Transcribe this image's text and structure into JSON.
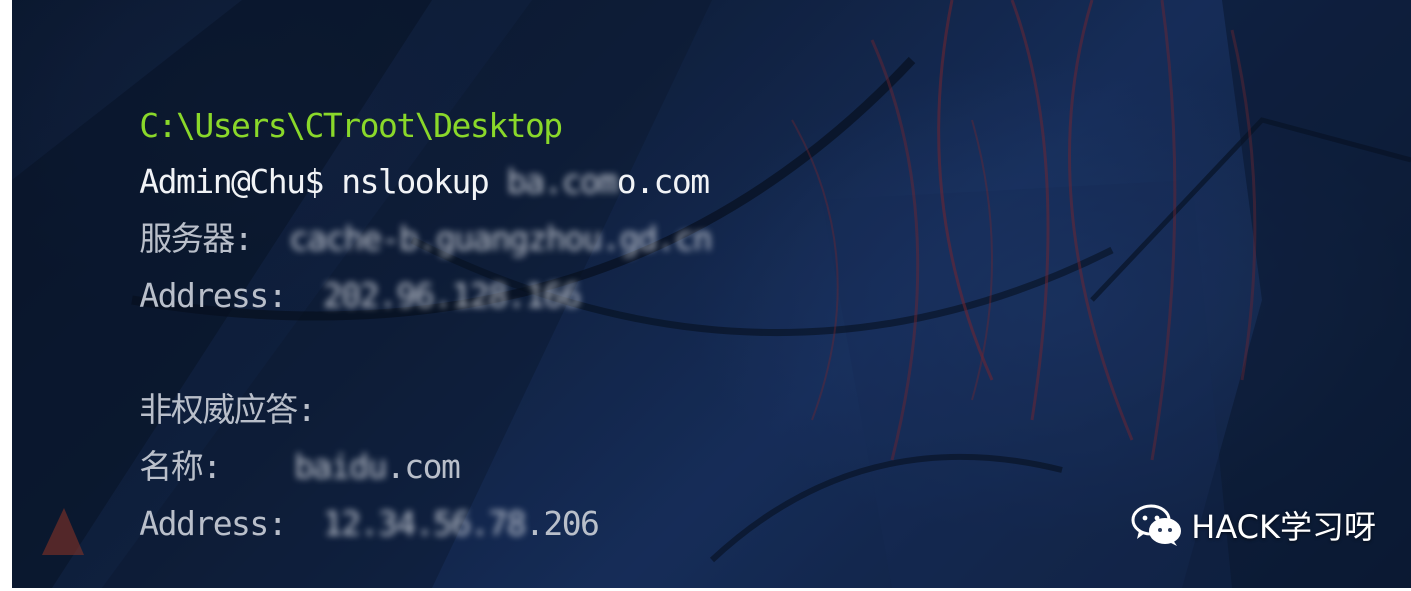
{
  "terminal": {
    "path_line": "C:\\Users\\CTroot\\Desktop",
    "prompt": "Admin@Chu$ ",
    "command": "nslookup ",
    "command_domain_redacted": "ba.com",
    "command_domain_visible": "o.com",
    "server_label": "服务器:  ",
    "server_value_redacted": "cache-b.guangzhou.gd.cn",
    "address_label": "Address:  ",
    "address_value_redacted": "202.96.128.166",
    "nonauth_label": "非权威应答:",
    "name_label": "名称:    ",
    "name_value_redacted": "baidu",
    "name_value_visible": ".com",
    "address2_label": "Address:  ",
    "address2_value_redacted": "12.34.56.78",
    "address2_value_visible": ".206"
  },
  "watermark": {
    "icon": "wechat-icon",
    "text": "HACK学习呀"
  },
  "colors": {
    "path": "#8ad82a",
    "text_bright": "#f1f3f6",
    "text_dim": "#b9bfca",
    "background": "#14284f"
  }
}
